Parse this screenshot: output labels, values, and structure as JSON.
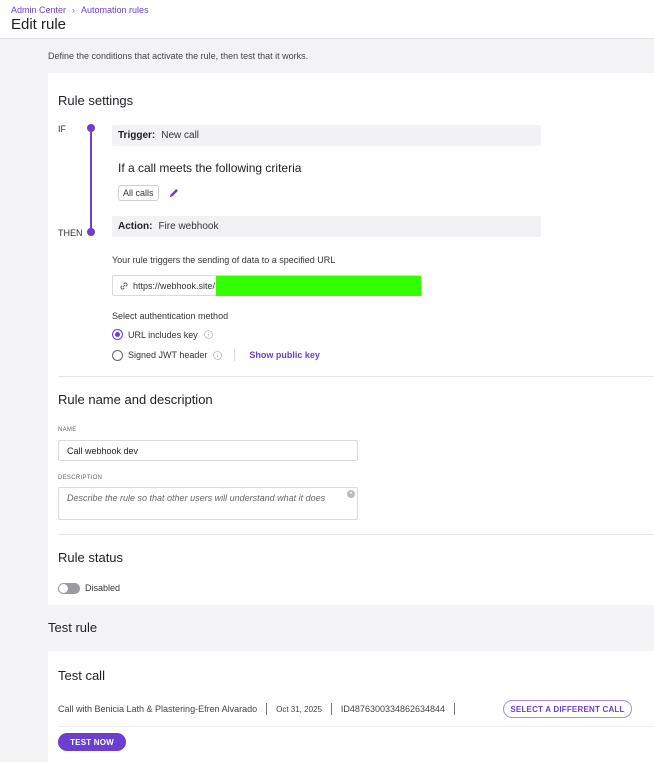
{
  "header": {
    "breadcrumbs": [
      "Admin Center",
      "Automation rules"
    ],
    "title": "Edit rule"
  },
  "intro": "Define the conditions that activate the rule, then test that it works.",
  "rule_settings": {
    "title": "Rule settings",
    "if_label": "IF",
    "then_label": "THEN",
    "trigger_key": "Trigger:",
    "trigger_value": "New call",
    "criteria_title": "If a call meets the following criteria",
    "criteria_chip": "All calls",
    "action_key": "Action:",
    "action_value": "Fire webhook",
    "url_intro": "Your rule triggers the sending of data to a specified URL",
    "url_value": "https://webhook.site/",
    "auth_label": "Select authentication method",
    "auth_options": [
      {
        "label": "URL includes key",
        "selected": true
      },
      {
        "label": "Signed JWT header",
        "selected": false
      }
    ],
    "show_public_key": "Show public key"
  },
  "name_section": {
    "title": "Rule name and description",
    "name_label": "NAME",
    "name_value": "Call webhook dev",
    "description_label": "DESCRIPTION",
    "description_placeholder": "Describe the rule so that other users will understand what it does"
  },
  "status_section": {
    "title": "Rule status",
    "toggle_label": "Disabled",
    "enabled": false
  },
  "test_rule": {
    "title": "Test rule",
    "card_title": "Test call",
    "call_name": "Call with Benicia Lath & Plastering-Efren Alvarado",
    "call_date": "Oct 31, 2025",
    "call_id": "ID4876300334862634844",
    "select_button": "SELECT A DIFFERENT CALL",
    "test_button": "TEST NOW"
  },
  "colors": {
    "accent": "#6b3fd1",
    "redaction": "#33ff00"
  }
}
